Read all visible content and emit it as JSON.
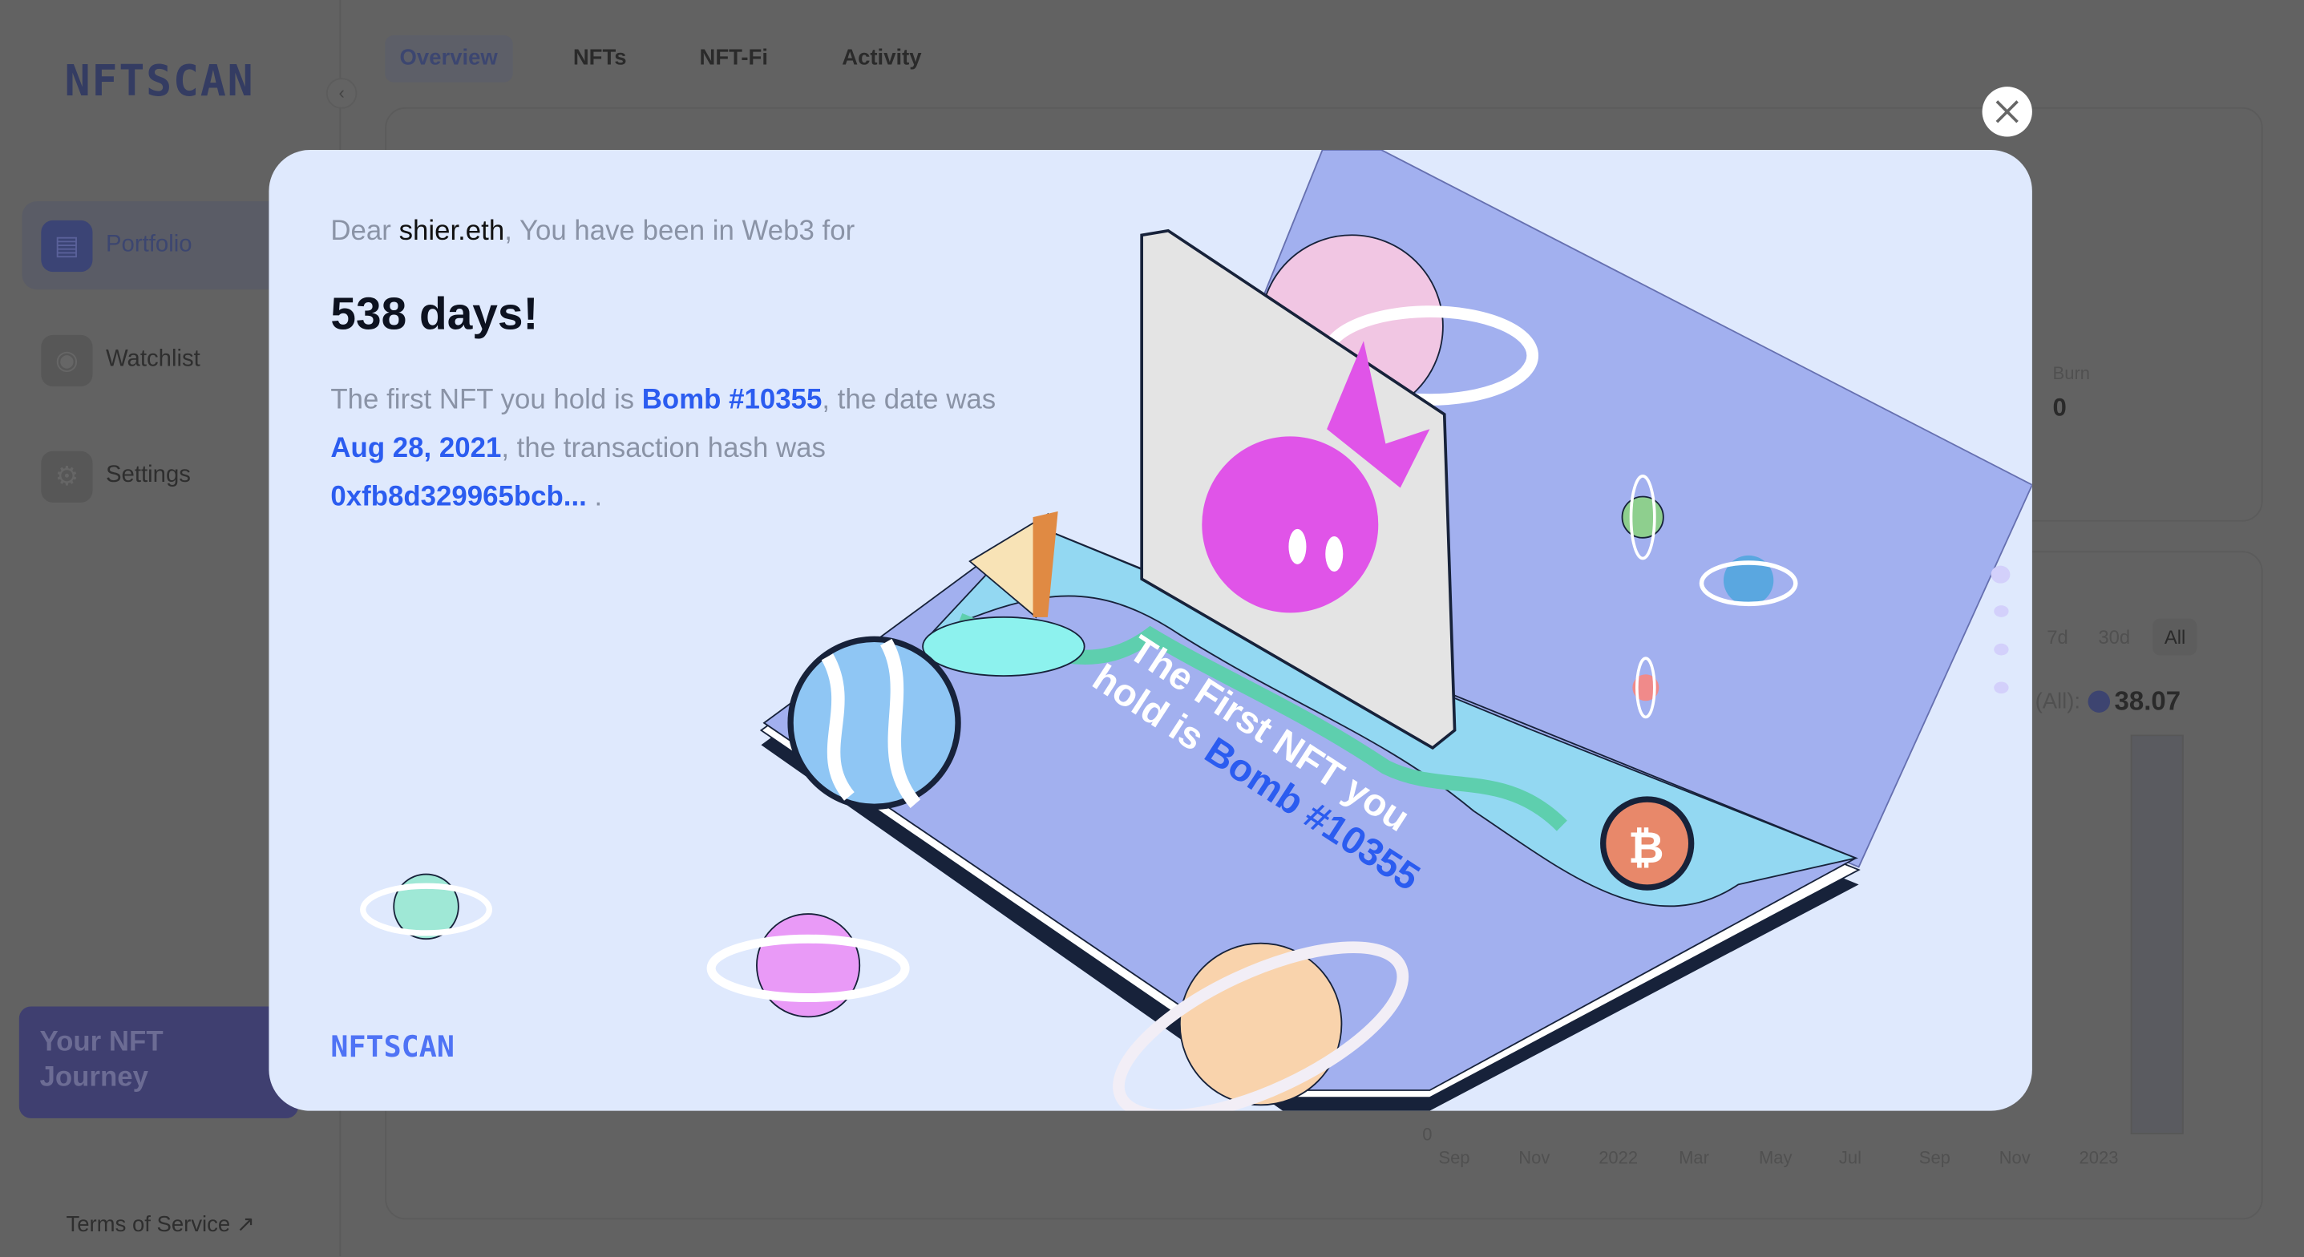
{
  "app": {
    "logo": "NFTSCAN"
  },
  "sidebar": {
    "collapse_icon": "chevron-left-icon",
    "items": [
      {
        "label": "Portfolio",
        "icon": "id-card-icon",
        "active": true
      },
      {
        "label": "Watchlist",
        "icon": "eye-icon"
      },
      {
        "label": "Settings",
        "icon": "gear-icon"
      }
    ],
    "banner": "Your NFT Journey",
    "terms": "Terms of Service"
  },
  "tabs": [
    {
      "label": "Overview",
      "active": true
    },
    {
      "label": "NFTs"
    },
    {
      "label": "NFT-Fi"
    },
    {
      "label": "Activity"
    }
  ],
  "background": {
    "burn_label": "Burn",
    "burn_value": "0",
    "ranges": [
      "7d",
      "30d",
      "All"
    ],
    "active_range": "All",
    "total_label": "(All):",
    "total_value": "38.07",
    "y_zero": "0",
    "x_ticks": [
      "Sep",
      "Nov",
      "2022",
      "Mar",
      "May",
      "Jul",
      "Sep",
      "Nov",
      "2023"
    ]
  },
  "modal": {
    "greeting_prefix": "Dear ",
    "username": "shier.eth",
    "greeting_suffix": ", You have been in Web3 for",
    "days": "538 days!",
    "p1": "The first NFT you hold is ",
    "nft_name": "Bomb #10355",
    "p2": ", the date was ",
    "date": "Aug 28, 2021",
    "p3": ", the transaction hash was ",
    "tx_hash": "0xfb8d329965bcb...",
    "p4": " .",
    "book_text_1": "The First NFT you",
    "book_text_2": "hold is ",
    "book_text_nft": "Bomb #10355",
    "logo": "NFTSCAN",
    "close_icon": "close-icon",
    "slides": 4,
    "active_slide": 1,
    "colors": {
      "bg": "#dfe9fd",
      "link": "#2b5cf0",
      "page": "#a2b0ef"
    }
  }
}
